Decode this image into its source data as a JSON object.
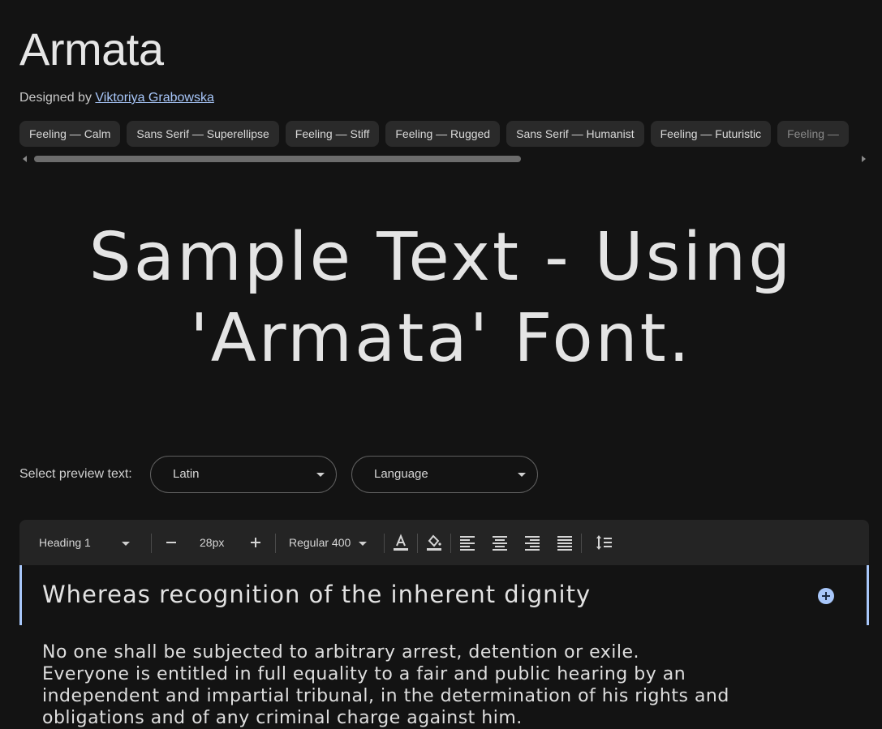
{
  "font": {
    "name": "Armata",
    "designed_by_label": "Designed by",
    "designer": "Viktoriya Grabowska"
  },
  "tags": [
    "Feeling — Calm",
    "Sans Serif — Superellipse",
    "Feeling — Stiff",
    "Feeling — Rugged",
    "Sans Serif — Humanist",
    "Feeling — Futuristic",
    "Feeling —"
  ],
  "sample": {
    "line1": "Sample Text - Using",
    "line2": "'Armata' Font."
  },
  "preview": {
    "label": "Select preview text:",
    "script_select": "Latin",
    "language_select": "Language"
  },
  "toolbar": {
    "style": "Heading 1",
    "size": "28px",
    "weight": "Regular 400",
    "icons": [
      "minus-icon",
      "plus-icon",
      "text-color-icon",
      "highlight-icon",
      "align-left-icon",
      "align-center-icon",
      "align-right-icon",
      "align-justify-icon",
      "line-height-icon"
    ]
  },
  "editor": {
    "heading": "Whereas recognition of the inherent dignity",
    "paragraph_line1": "No one shall be subjected to arbitrary arrest, detention or exile.",
    "paragraph_line2": "Everyone is entitled in full equality to a fair and public hearing by an independent and impartial tribunal, in the determination of his rights and obligations and of any criminal charge against him."
  },
  "colors": {
    "background": "#131313",
    "accent": "#a8c7fa",
    "toolbar": "#242424",
    "chip": "#2a2a2a"
  }
}
